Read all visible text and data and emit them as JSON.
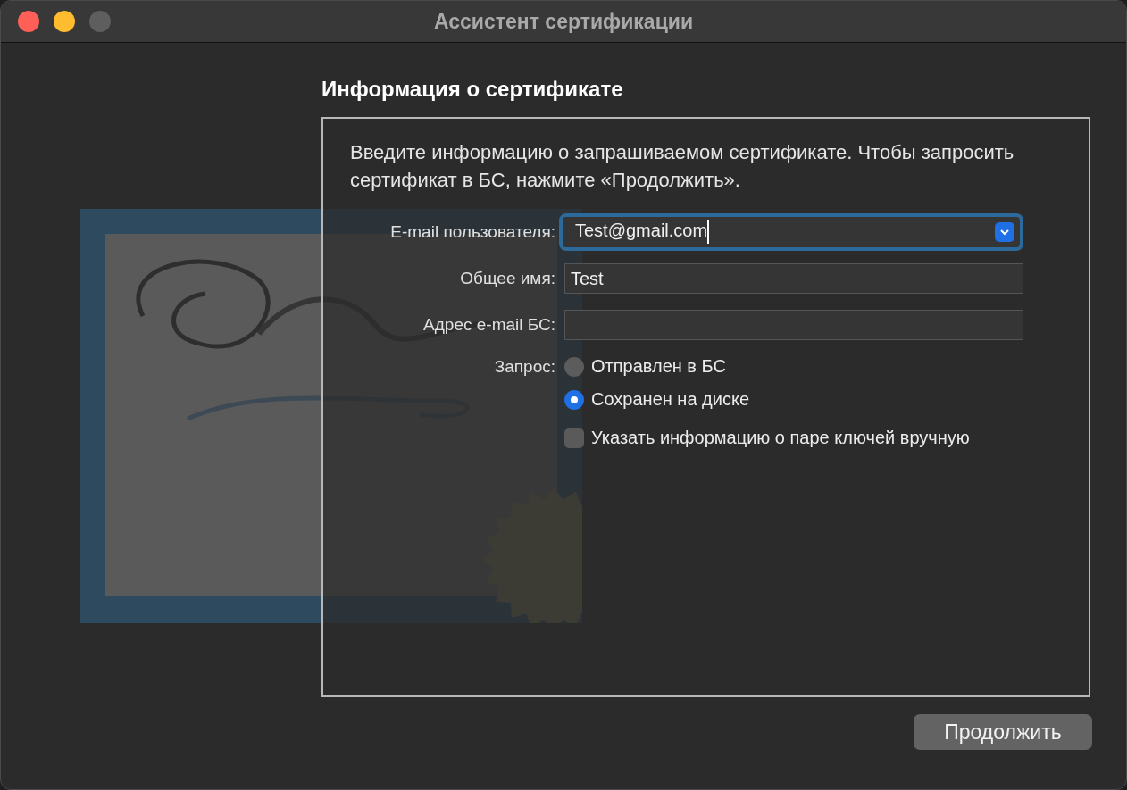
{
  "window": {
    "title": "Ассистент сертификации"
  },
  "heading": "Информация о сертификате",
  "intro": "Введите информацию о запрашиваемом сертификате. Чтобы запросить сертификат в БС, нажмите «Продолжить».",
  "fields": [
    {
      "label": "E-mail пользователя:",
      "value": "Test@gmail.com",
      "kind": "combo",
      "focused": true
    },
    {
      "label": "Общее имя:",
      "value": "Test",
      "kind": "text",
      "focused": false
    },
    {
      "label": "Адрес e-mail БС:",
      "kind": "text",
      "focused": false
    }
  ],
  "request": {
    "label": "Запрос:",
    "options": [
      {
        "label": "Отправлен в БС",
        "selected": false
      },
      {
        "label": "Сохранен на диске",
        "selected": true
      }
    ]
  },
  "manual_keys": {
    "label": "Указать информацию о паре ключей вручную",
    "checked": false
  },
  "buttons": [
    {
      "label": "Продолжить"
    }
  ]
}
